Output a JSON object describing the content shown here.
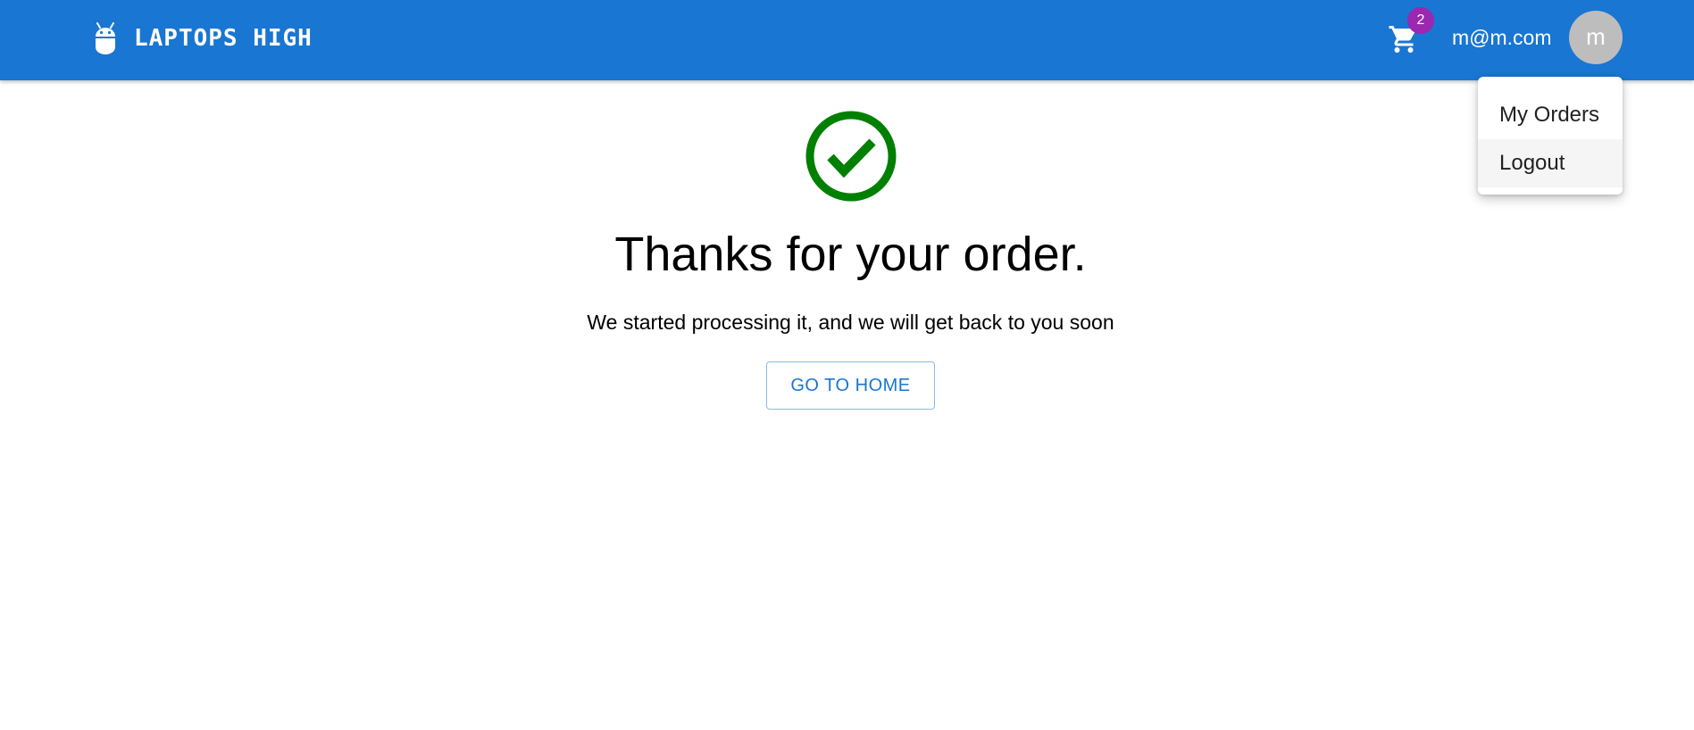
{
  "header": {
    "brand_title": "LAPTOPS HIGH",
    "brand_icon": "android-icon",
    "cart_icon": "shopping-cart-icon",
    "cart_count": "2",
    "user_email": "m@m.com",
    "avatar_initial": "m"
  },
  "user_menu": {
    "items": [
      {
        "label": "My Orders"
      },
      {
        "label": "Logout"
      }
    ]
  },
  "main": {
    "status_icon": "check-circle-icon",
    "title": "Thanks for your order.",
    "message": "We started processing it, and we will get back to you soon",
    "home_button_label": "GO TO HOME"
  },
  "colors": {
    "appbar": "#1976d2",
    "badge": "#9c27b0",
    "success": "#008000",
    "avatar": "#bdbdbd"
  }
}
